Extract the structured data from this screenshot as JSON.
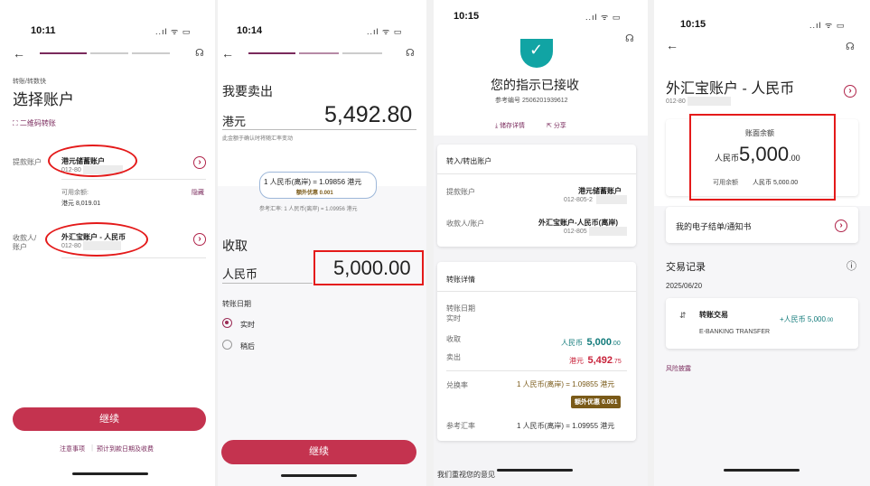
{
  "status_bar": {
    "signal": "..ıl ᯤ ▭"
  },
  "screen1": {
    "time": "10:11",
    "breadcrumb": "转账/转数快",
    "title": "选择账户",
    "qr_link": "二维码转账",
    "from_label": "提款账户",
    "from_account_name": "港元储蓄账户",
    "from_account_no": "012-80",
    "available_label": "可用余额:",
    "hide_link": "隐藏",
    "available_value": "港元 8,019.01",
    "to_label_line1": "收款人/",
    "to_label_line2": "账户",
    "to_account_name": "外汇宝账户 - 人民币",
    "to_account_no": "012-80",
    "continue_button": "继续",
    "notes_link": "注意事项",
    "fees_link": "预计到款日期及收费"
  },
  "screen2": {
    "time": "10:14",
    "sell_title": "我要卖出",
    "sell_currency": "港元",
    "sell_amount": "5,492.80",
    "sell_note": "此金额于确认时将随汇率变动",
    "rate_text": "1 人民币(离岸) = 1.09856 港元",
    "rate_promo": "额外优惠 0.001",
    "ref_rate": "参考汇率: 1 人民币(离岸) = 1.09956 港元",
    "receive_title": "收取",
    "receive_currency": "人民币",
    "receive_amount": "5,000.00",
    "date_label": "转账日期",
    "option_now": "实时",
    "option_later": "稍后",
    "continue_button": "继续"
  },
  "screen3": {
    "time": "10:15",
    "success_title": "您的指示已接收",
    "reference": "参考编号 2506201939612",
    "save_link": "储存详情",
    "share_link": "分享",
    "accounts_header": "转入/转出账户",
    "from_label": "提款账户",
    "from_name": "港元储蓄账户",
    "from_no": "012-805-2",
    "to_label": "收款人/账户",
    "to_name": "外汇宝账户-人民币(离岸)",
    "to_no": "012-805",
    "details_header": "转账详情",
    "date_label_1": "转账日期",
    "date_label_2": "实时",
    "receive_label": "收取",
    "receive_ccy": "人民币",
    "receive_amt": "5,000",
    "receive_dec": ".00",
    "sell_label": "卖出",
    "sell_ccy": "港元",
    "sell_amt": "5,492",
    "sell_dec": ".75",
    "rate_label": "兑换率",
    "rate_value": "1 人民币(离岸) = 1.09855 港元",
    "rate_promo": "额外优惠 0.001",
    "ref_rate_label": "参考汇率",
    "ref_rate_value": "1 人民币(离岸) = 1.09955 港元",
    "bottom_text": "我们重视您的意见"
  },
  "screen4": {
    "time": "10:15",
    "account_title": "外汇宝账户 - 人民币",
    "account_no": "012-80",
    "balance_label": "账面余额",
    "balance_ccy": "人民币",
    "balance_int": "5,000",
    "balance_dec": ".00",
    "available_label": "可用余额",
    "available_value": "人民币 5,000.00",
    "statements_link": "我的电子结单/通知书",
    "records_title": "交易记录",
    "record_date": "2025/06/20",
    "record_title": "转账交易",
    "record_amount": "+人民币 5,000",
    "record_dec": ".00",
    "record_desc": "E-BANKING TRANSFER",
    "risk_link": "风险披露"
  },
  "colors": {
    "brand": "#c4334f",
    "annotation_red": "#e41a1a",
    "progress_purple": "#7a2a5c",
    "success_teal": "#11a4a4"
  }
}
